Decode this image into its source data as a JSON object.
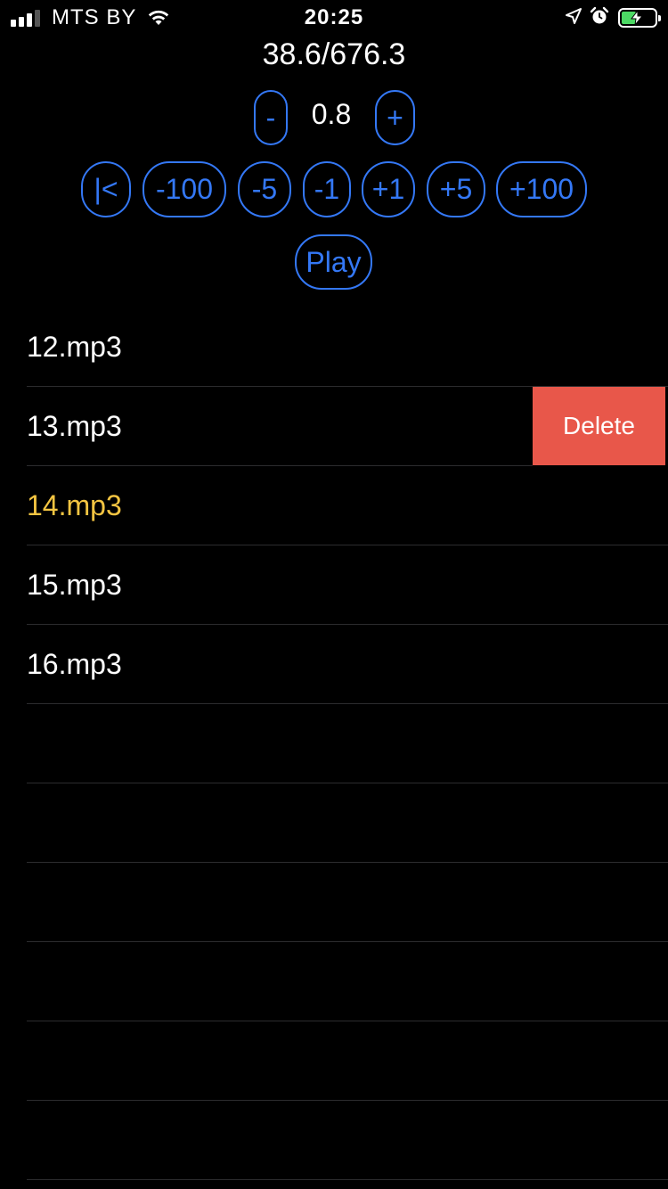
{
  "status_bar": {
    "carrier": "MTS BY",
    "time": "20:25",
    "signal_bars_active": 3,
    "signal_bars_total": 4,
    "battery_color": "#4cd964",
    "icons": [
      "signal-icon",
      "wifi-icon",
      "location-icon",
      "alarm-icon",
      "battery-charging-icon"
    ]
  },
  "player": {
    "position": "38.6/676.3",
    "speed": {
      "decrease_label": "-",
      "value": "0.8",
      "increase_label": "+"
    },
    "seek": {
      "start_label": "|<",
      "back_100_label": "-100",
      "back_5_label": "-5",
      "back_1_label": "-1",
      "fwd_1_label": "+1",
      "fwd_5_label": "+5",
      "fwd_100_label": "+100"
    },
    "play_label": "Play",
    "accent_color": "#3478f6"
  },
  "tracks": {
    "items": [
      {
        "label": "12.mp3"
      },
      {
        "label": "13.mp3"
      },
      {
        "label": "14.mp3"
      },
      {
        "label": "15.mp3"
      },
      {
        "label": "16.mp3"
      }
    ],
    "current_index": 2,
    "current_color": "#f4c542",
    "swiped_index": 1,
    "delete_label": "Delete",
    "delete_color": "#e8574a"
  }
}
